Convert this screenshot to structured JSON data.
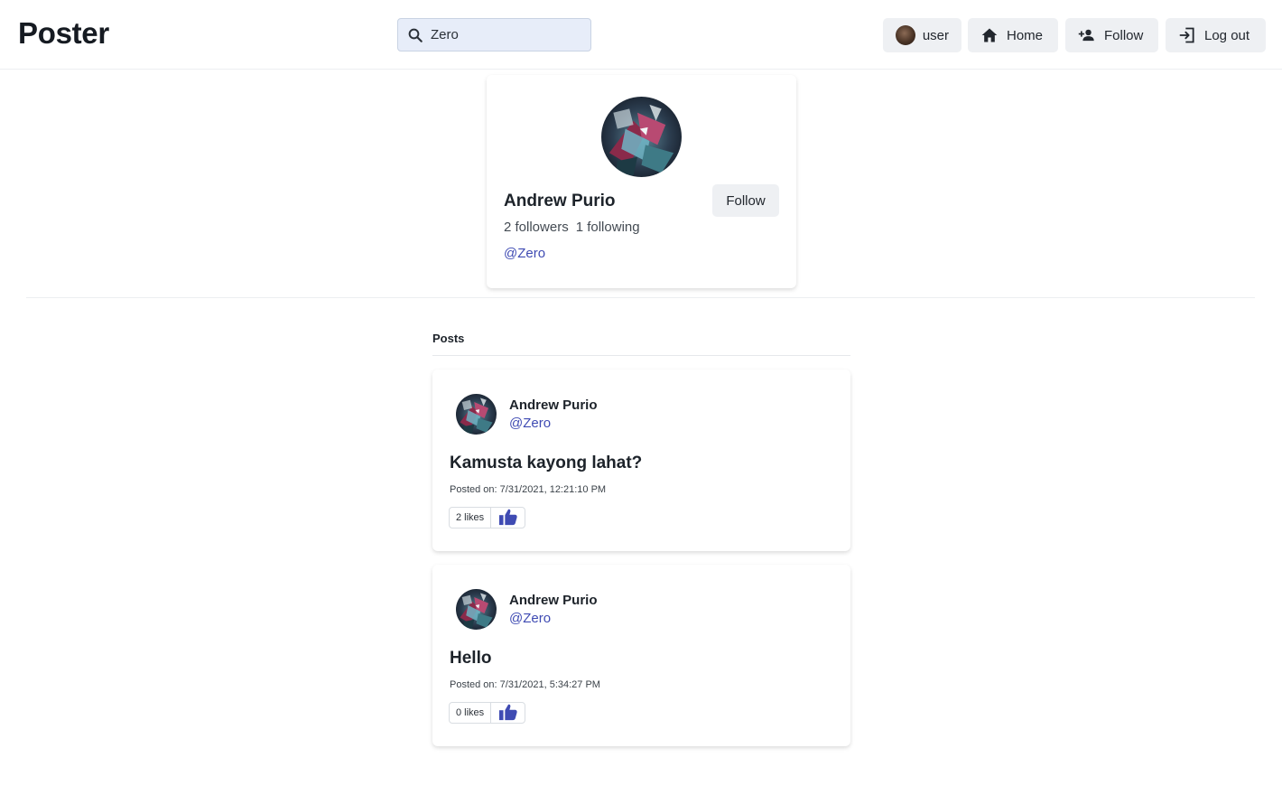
{
  "header": {
    "logo": "Poster",
    "search": {
      "value": "Zero",
      "placeholder": ""
    },
    "nav": {
      "user_label": "user",
      "home_label": "Home",
      "follow_label": "Follow",
      "logout_label": "Log out"
    }
  },
  "profile": {
    "name": "Andrew Purio",
    "followers": "2 followers",
    "following": "1 following",
    "handle": "@Zero",
    "follow_button": "Follow"
  },
  "posts_section": {
    "title": "Posts",
    "posts": [
      {
        "author": "Andrew Purio",
        "handle": "@Zero",
        "title": "Kamusta kayong lahat?",
        "posted_on": "Posted on: 7/31/2021, 12:21:10 PM",
        "likes": "2 likes"
      },
      {
        "author": "Andrew Purio",
        "handle": "@Zero",
        "title": "Hello",
        "posted_on": "Posted on: 7/31/2021, 5:34:27 PM",
        "likes": "0 likes"
      }
    ]
  },
  "icons": {
    "search": "search-icon",
    "home": "home-icon",
    "follow": "person-add-icon",
    "logout": "logout-icon",
    "like": "thumbs-up-icon"
  },
  "colors": {
    "accent": "#3f4bb3",
    "search_bg": "#e7edf9",
    "button_bg": "#eef0f3"
  }
}
